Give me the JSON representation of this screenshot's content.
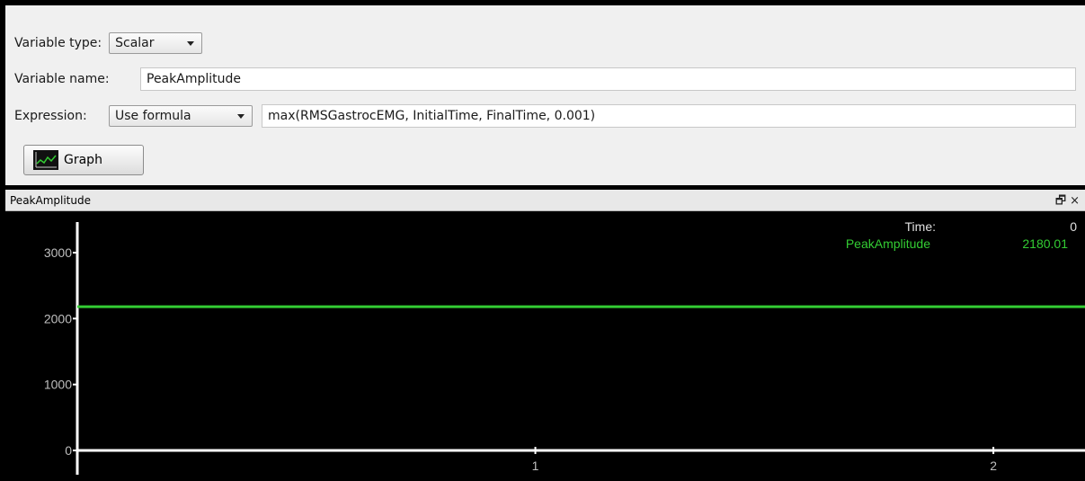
{
  "form": {
    "variable_type": {
      "label": "Variable type:",
      "value": "Scalar"
    },
    "variable_name": {
      "label": "Variable name:",
      "value": "PeakAmplitude"
    },
    "expression": {
      "label": "Expression:",
      "mode": "Use formula",
      "formula": "max(RMSGastrocEMG, InitialTime, FinalTime, 0.001)"
    },
    "graph_button": {
      "label": "Graph",
      "icon": "graph-icon"
    }
  },
  "plot_panel": {
    "title": "PeakAmplitude",
    "controls": {
      "float": "🗗",
      "close": "×"
    },
    "legend": {
      "time_label": "Time:",
      "time_value": "0",
      "series_label": "PeakAmplitude",
      "series_value": "2180.01"
    }
  },
  "colors": {
    "series": "#33cc33",
    "axes": "#ffffff",
    "background": "#000000",
    "tick_text": "#bfbfbf"
  },
  "chart_data": {
    "type": "line",
    "series": [
      {
        "name": "PeakAmplitude",
        "x": [
          0,
          2.2
        ],
        "y": [
          2180.01,
          2180.01
        ]
      }
    ],
    "yticks": [
      0,
      1000,
      2000,
      3000
    ],
    "xticks": [
      1,
      2
    ],
    "xlim": [
      0,
      2.2
    ],
    "ylim": [
      0,
      3600
    ],
    "grid": false
  }
}
